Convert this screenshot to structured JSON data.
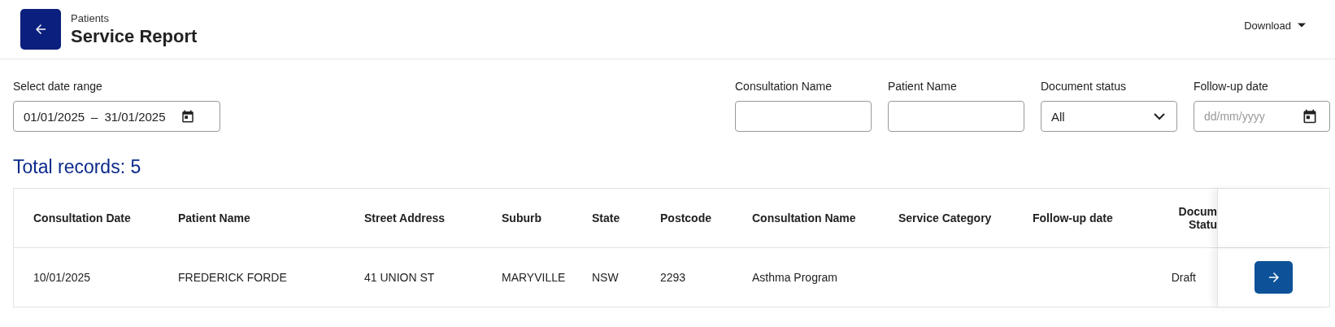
{
  "header": {
    "breadcrumb": "Patients",
    "title": "Service Report",
    "download": "Download"
  },
  "date_range": {
    "label": "Select date range",
    "start": "01/01/2025",
    "separator": "–",
    "end": "31/01/2025"
  },
  "filters": [
    {
      "kind": "text",
      "label": "Consultation Name"
    },
    {
      "kind": "text",
      "label": "Patient Name"
    },
    {
      "kind": "select",
      "label": "Document status",
      "value": "All"
    },
    {
      "kind": "date",
      "label": "Follow-up date",
      "placeholder": "dd/mm/yyyy"
    }
  ],
  "total_records": "Total records: 5",
  "table": {
    "columns": [
      "Consultation Date",
      "Patient Name",
      "Street Address",
      "Suburb",
      "State",
      "Postcode",
      "Consultation Name",
      "Service Category",
      "Follow-up date",
      "Docum Statu"
    ],
    "rows": [
      {
        "cells": [
          "10/01/2025",
          "FREDERICK FORDE",
          "41 UNION ST",
          "MARYVILLE",
          "NSW",
          "2293",
          "Asthma Program",
          "",
          "",
          "Draft"
        ]
      }
    ]
  }
}
